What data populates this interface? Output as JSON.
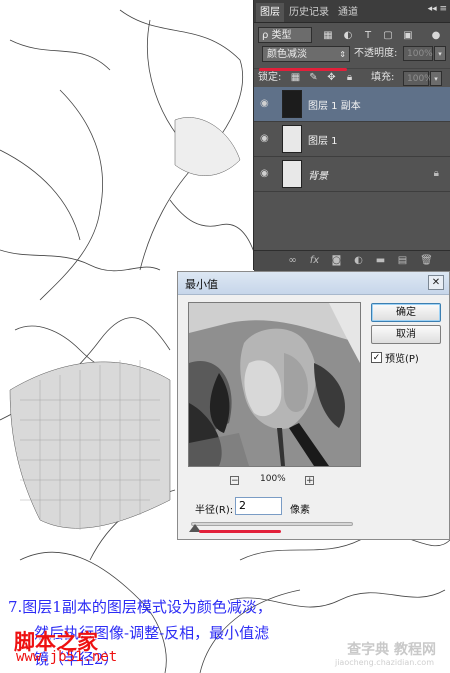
{
  "layers_panel": {
    "tabs": [
      "图层",
      "历史记录",
      "通道"
    ],
    "menu_glyph": "◂◂ ≡",
    "filter_kind": "ρ 类型",
    "blend_mode": "颜色减淡",
    "opacity_label": "不透明度:",
    "opacity_value": "100%",
    "lock_label": "锁定:",
    "fill_label": "填充:",
    "fill_value": "100%",
    "layers": [
      {
        "name": "图层 1 副本",
        "selected": true
      },
      {
        "name": "图层 1",
        "selected": false
      },
      {
        "name": "背景",
        "selected": false,
        "locked": true
      }
    ],
    "footer_icons": [
      "link-icon",
      "fx-icon",
      "mask-icon",
      "adjustment-icon",
      "group-icon",
      "new-layer-icon",
      "trash-icon"
    ]
  },
  "dialog": {
    "title": "最小值",
    "ok_label": "确定",
    "cancel_label": "取消",
    "preview_label": "预览(P)",
    "preview_checked": true,
    "zoom_minus": "−",
    "zoom_plus": "+",
    "zoom_value": "100%",
    "radius_label": "半径(R):",
    "radius_value": "2",
    "radius_unit": "像素"
  },
  "caption": {
    "line1": "7.图层1副本的图层模式设为颜色减淡，",
    "line2": "然后执行图像-调整-反相，最小值滤",
    "line3": "镜（半径2）"
  },
  "watermark": {
    "site_cn": "脚本之家",
    "site_url": "www.jb51.net",
    "corner_cn": "查字典 教程网",
    "corner_url": "jiaocheng.chazidian.com"
  },
  "colors": {
    "accent_red": "#e2203a",
    "caption_blue": "#2c2cf5",
    "panel": "#535353",
    "selected_layer": "#5f7189"
  }
}
